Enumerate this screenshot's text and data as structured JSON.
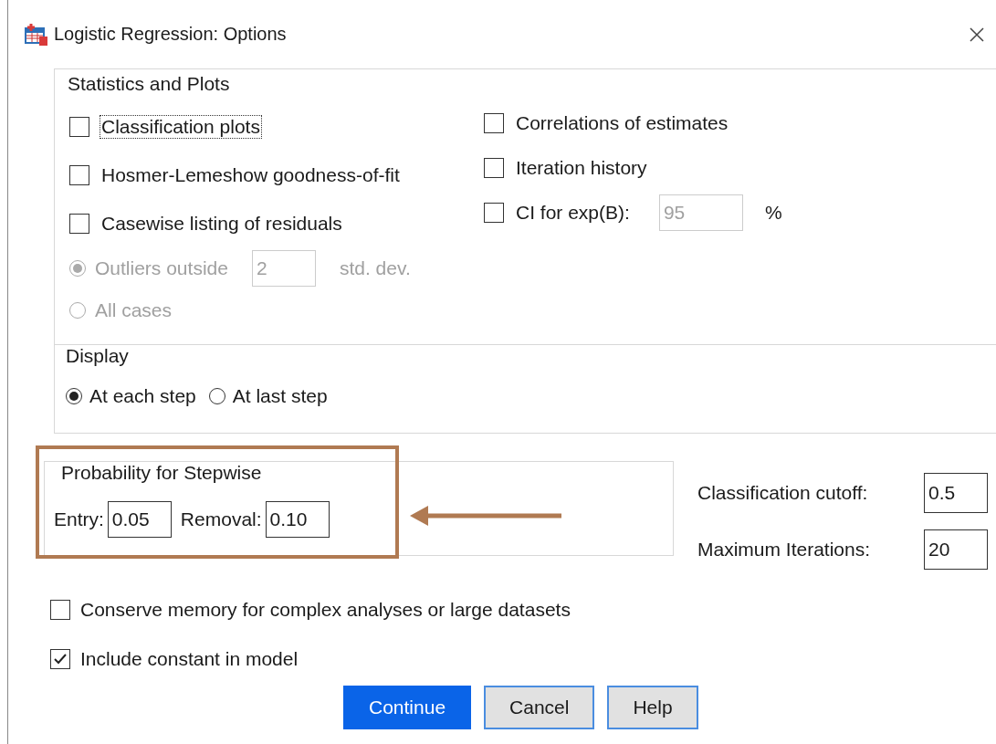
{
  "window": {
    "title": "Logistic Regression: Options"
  },
  "statistics_and_plots": {
    "title": "Statistics and Plots",
    "left_options": [
      {
        "label": "Classification plots",
        "checked": false,
        "focused": true
      },
      {
        "label": "Hosmer-Lemeshow goodness-of-fit",
        "checked": false,
        "focused": false
      },
      {
        "label": "Casewise listing of residuals",
        "checked": false,
        "focused": false
      }
    ],
    "residual_radios": [
      {
        "label": "Outliers outside",
        "selected": true,
        "disabled": true,
        "value": "2",
        "unit": "std. dev."
      },
      {
        "label": "All cases",
        "selected": false,
        "disabled": true
      }
    ],
    "right_options": [
      {
        "label": "Correlations of estimates",
        "checked": false
      },
      {
        "label": "Iteration history",
        "checked": false
      },
      {
        "label": "CI for exp(B):",
        "checked": false,
        "value": "95",
        "value_disabled": true,
        "unit": "%"
      }
    ],
    "display": {
      "title": "Display",
      "radios": [
        {
          "label": "At each step",
          "selected": true
        },
        {
          "label": "At last step",
          "selected": false
        }
      ]
    }
  },
  "probability": {
    "title": "Probability for Stepwise",
    "fields": [
      {
        "label": "Entry:",
        "value": "0.05"
      },
      {
        "label": "Removal:",
        "value": "0.10"
      }
    ]
  },
  "right_fields": [
    {
      "label": "Classification cutoff:",
      "value": "0.5"
    },
    {
      "label": "Maximum Iterations:",
      "value": "20"
    }
  ],
  "bottom_options": [
    {
      "label": "Conserve memory for complex analyses or large datasets",
      "checked": false
    },
    {
      "label": "Include constant in model",
      "checked": true
    }
  ],
  "buttons": [
    {
      "label": "Continue",
      "default": true
    },
    {
      "label": "Cancel",
      "default": false
    },
    {
      "label": "Help",
      "default": false
    }
  ]
}
